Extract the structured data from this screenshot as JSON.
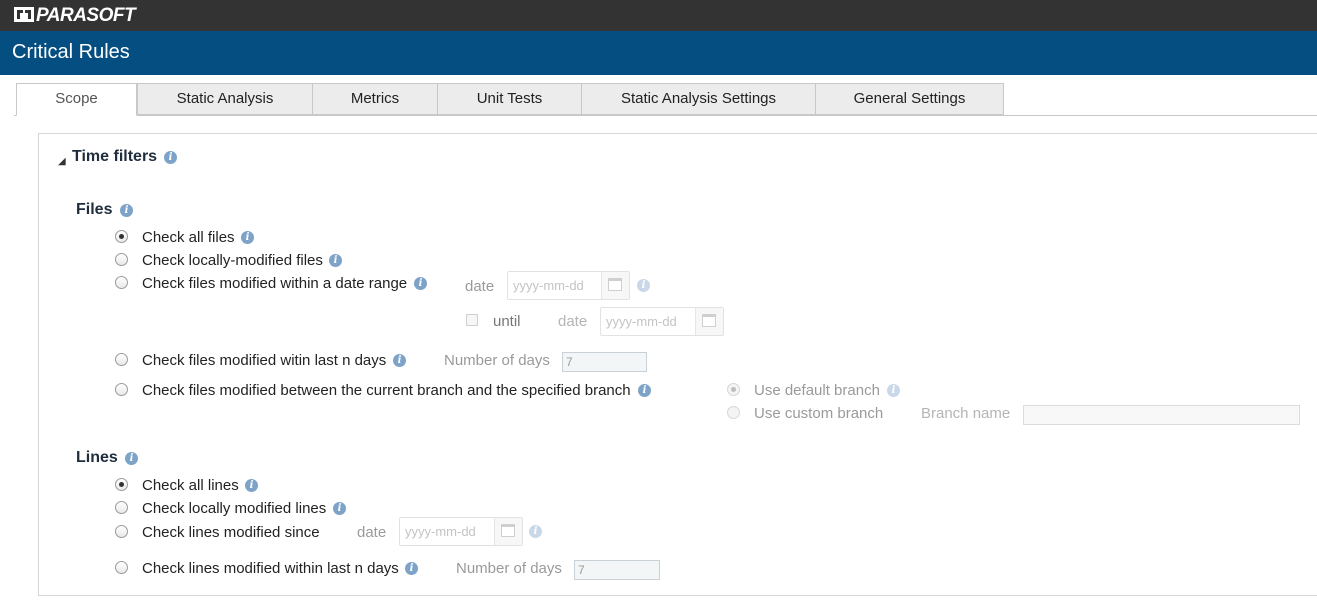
{
  "brand": {
    "logo_text": "PARASOFT"
  },
  "page": {
    "title": "Critical Rules"
  },
  "tabs": [
    "Scope",
    "Static Analysis",
    "Metrics",
    "Unit Tests",
    "Static Analysis Settings",
    "General Settings"
  ],
  "time_filters": {
    "title": "Time filters",
    "files": {
      "title": "Files",
      "options": [
        "Check all files",
        "Check locally-modified files",
        "Check files modified within a date range",
        "Check files modified witin last n days",
        "Check files modified between the current branch and the specified branch"
      ],
      "selected": "Check all files",
      "date_label": "date",
      "date_placeholder": "yyyy-mm-dd",
      "until_label": "until",
      "until_date_label": "date",
      "until_date_placeholder": "yyyy-mm-dd",
      "days_label": "Number of days",
      "days_value": "7",
      "branch": {
        "default_label": "Use default branch",
        "custom_label": "Use custom branch",
        "name_label": "Branch name",
        "name_value": ""
      }
    },
    "lines": {
      "title": "Lines",
      "options": [
        "Check all lines",
        "Check locally modified lines",
        "Check lines modified since",
        "Check lines modified within last n days"
      ],
      "selected": "Check all lines",
      "date_label": "date",
      "date_placeholder": "yyyy-mm-dd",
      "days_label": "Number of days",
      "days_value": "7"
    }
  },
  "colors": {
    "topbar": "#333333",
    "titlebar": "#044e82",
    "info": "#7ea3c8"
  }
}
